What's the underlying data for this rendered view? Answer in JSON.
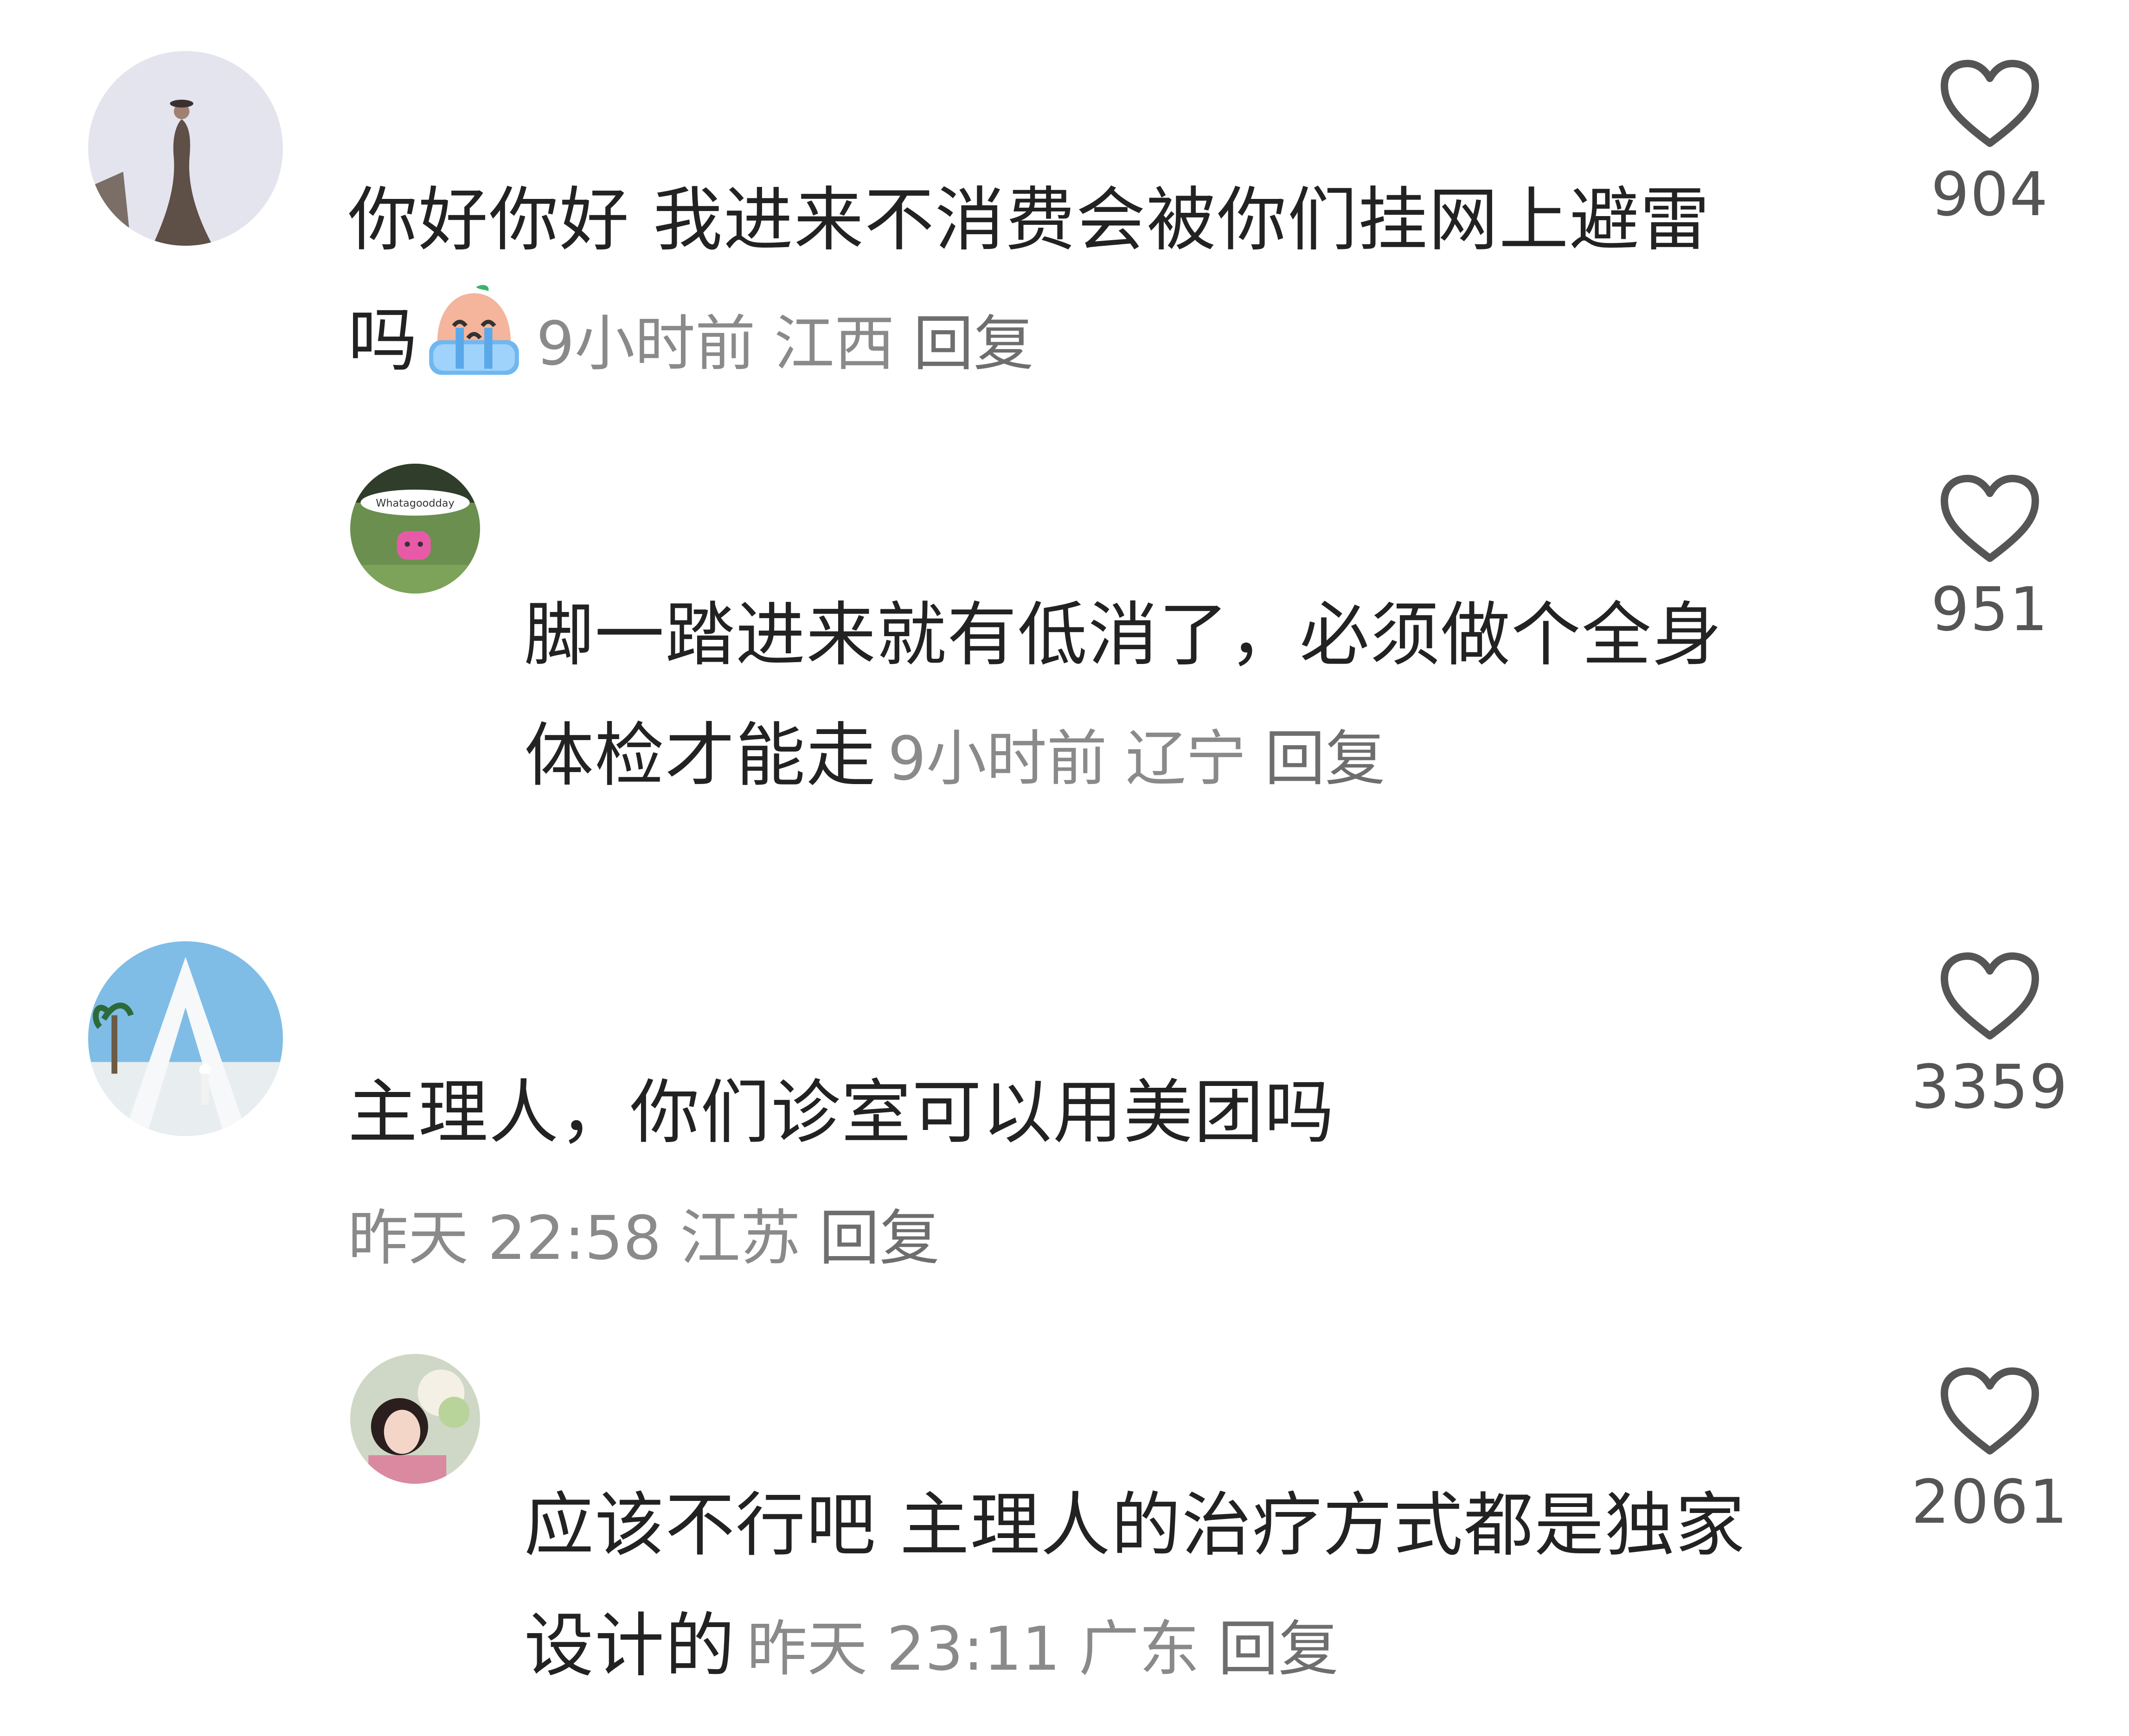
{
  "comments": [
    {
      "text": "你好你好 我进来不消费会被你们挂网上避雷吗",
      "text_line1": "你好你好 我进来不消费会被你们挂网上避雷",
      "text_line2": "吗",
      "emoji": "crying-face-emoji",
      "time": "9小时前",
      "location": "江西",
      "reply_label": "回复",
      "likes": "904"
    },
    {
      "text_line1": "脚一踏进来就有低消了，必须做个全身",
      "text_line2": "体检才能走",
      "avatar_caption": "Whatagoodday",
      "time": "9小时前",
      "location": "辽宁",
      "reply_label": "回复",
      "likes": "951"
    },
    {
      "text_line1": "主理人，你们诊室可以用美团吗",
      "time": "昨天 22:58",
      "location": "江苏",
      "reply_label": "回复",
      "likes": "3359"
    },
    {
      "text_line1": "应该不行吧 主理人的治疗方式都是独家",
      "text_line2": "设计的",
      "time": "昨天 23:11",
      "location": "广东",
      "reply_label": "回复",
      "likes": "2061"
    }
  ],
  "icons": {
    "like": "heart-outline-icon"
  },
  "colors": {
    "text": "#222222",
    "meta": "#8a8a8a",
    "icon": "#555555",
    "background": "#ffffff"
  }
}
